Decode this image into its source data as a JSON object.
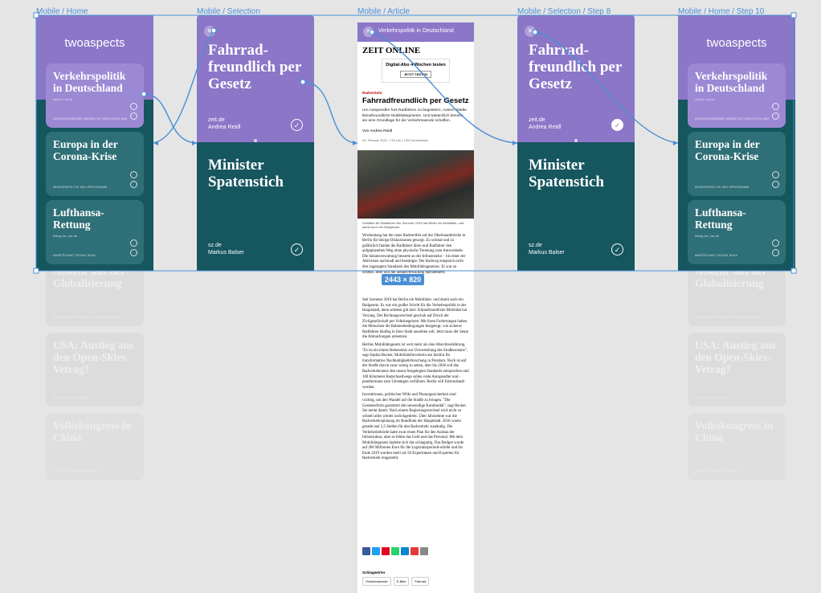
{
  "frames": {
    "home": {
      "label": "Mobile / Home",
      "brand_light": "two",
      "brand_bold": "aspects"
    },
    "selection": {
      "label": "Mobile / Selection"
    },
    "article": {
      "label": "Mobile / Article"
    },
    "selection_step8": {
      "label": "Mobile / Selection / Step 8"
    },
    "home_step10": {
      "label": "Mobile / Home / Step 10"
    }
  },
  "home_cards": [
    {
      "title": "Verkehrspolitik in Deutschland",
      "source": "zeit.de | sz.de",
      "tags": "#VERKEHRSWENDE #MOBILITÄT #DEUTSCHLAND"
    },
    {
      "title": "Europa in der Corona-Krise",
      "source": "",
      "tags": "#EUROPAPOLITIK #EU #PROGRAMM"
    },
    {
      "title": "Lufthansa-Rettung",
      "source": "hellog.de | faz.de",
      "tags": "#WIRTSCHAFT #STAAT #DAX"
    }
  ],
  "ghost_cards": [
    {
      "title": "Abkehr aus der Globalisierung",
      "tags": "#WIRTSCHAFT #HANDEL #GLOBALISIERUNG"
    },
    {
      "title": "USA: Austieg aus den Open-Skies-Vetrag?",
      "tags": "#POLITIK #USA #TRUMP"
    },
    {
      "title": "Volkskongress in China",
      "tags": "#POLITIK #CHINA #KONGRESS"
    }
  ],
  "selection": {
    "top_title": "Fahrrad-freundlich per Gesetz",
    "top_source": "zeit.de",
    "top_author": "Andrea Reidl",
    "bottom_title": "Minister Spatenstich",
    "bottom_source": "sz.de",
    "bottom_author": "Markus Balser"
  },
  "article": {
    "bar_title": "Verkehrspolitik in Deutschland",
    "outlet": "ZEIT ONLINE",
    "ad_text": "Digital-Abo 4 Wochen testen",
    "ad_button": "JETZT TESTEN",
    "kicker": "Radverkehr",
    "headline": "Fahrradfreundlich per Gesetz",
    "lead": "Um Autopendler fürs Radfahren zu begeistern, nutzen Städte klimafreundliche Mobilitätsgesetze. Und tatsächlich können sie eine Grundlage für die Verkehrswende schaffen.",
    "byline": "Von Andrea Reidl",
    "date": "25. Februar 2020, 7:20 Uhr | 139 Kommentare",
    "caption": "Verfallen für Radfahrer! Am Sommer 2018 hat Berlin ein Mobilitäts- und damit auch ein Radgesetz.",
    "paragraphs": [
      "Wochenlang hat der neue Radstreifen auf der Oberbaumbrücke in Berlin für hitzige Diskussionen gesorgt. Zu schmal und zu gefährlich fanden die Radfahrer ihren und Radfahrer den aufgepinselten Weg ohne physische Trennung zum Autoverkehr. Die Senatsverwaltung besserte an der Infrastruktur – bis einer der Aktivisten nachmaß und bestätigte: Der Radweg entsprach nicht den zugesagten Standards des Mobilitätsgesetzes. Er war zu schmal. Jetzt will die Senatsverwaltung nachbessern.",
      "Seit Sommer 2018 hat Berlin ein Mobilitäts- und damit auch ein Radgesetz. Es war ein großer Schritt für die Verkehrspolitik in der Hauptstadt, denn seitdem gilt dort: Klimafreundliche Mobilität hat Vorrang. Der Richtungswechsel geschah auf Druck der Zivilgesellschaft per Volksbegehren. Mit ihren Forderungen haben die Menschen die Rahmenbedingungen festgelegt, wie sicheres Radfahren künftig in ihrer Stadt aussehen soll. Jetzt muss der Senat die Abmachungen umsetzen.",
      "Berlins Mobilitätsgesetz ist weit mehr als eine Absichtserklärung. \"Es ist ein klares Bekenntnis zur Umverteilung des Straßenraums\", sagt Sophia Becker, Mobilitätsforscherin am Institut für transformative Nachhaltigkeitsforschung in Potsdam. Noch ist auf der Straße davon zwar wenig zu sehen, aber bis 2030 soll das Radverkehrsnetz den neuen festgelegten Standards entsprechen und 100 Kilometer Radschnellwege sollen viele Autopendler und -pendlerinnen zum Umsteigen verführen. Berlin will Fahrradstadt werden.",
      "Investitionen, politischer Wille und Planungssicherheit sind wichtig, um den Wandel auf die Straße zu bringen. \"Die Gesetzesform garantiert die notwendige Kontinuität\", sagt Becker. Sie meint damit: Nach einem Regierungswechsel wird nicht so schnell alles wieder zurückgedreht. Über Jahrzehnte war die Radverkehrsplanung im Rundfunk der Hauptstadt. 2016 waren gerade mal 3,5 Stellen für den Radverkehr zuständig. Die Verkehrsbehörde hatte zwar einen Plan für den Ausbau der Infrastruktur, aber es fehlte das Geld und das Personal. Mit dem Mobilitätsgesetz änderte sich das schlagartig. Das Budget wurde auf 200 Millionen Euro für die Legislaturperiode erhöht und bis Ende 2019 wurden mehr als 50 Expertinnen und Experten für Radverkehr eingestellt."
    ],
    "keywords_label": "Schlagwörter",
    "keywords": [
      "Verkehrswende",
      "E-Bike",
      "Fahrrad"
    ]
  },
  "size_badge": "2443 × 820",
  "colors": {
    "purple": "#8b76c8",
    "teal": "#15565f",
    "selection_blue": "#4a8fd6",
    "canvas": "#e5e5e5"
  },
  "share_colors": [
    "#3b5998",
    "#1da1f2",
    "#e60023",
    "#25d366",
    "#0088cc",
    "#e53935",
    "#888888"
  ]
}
